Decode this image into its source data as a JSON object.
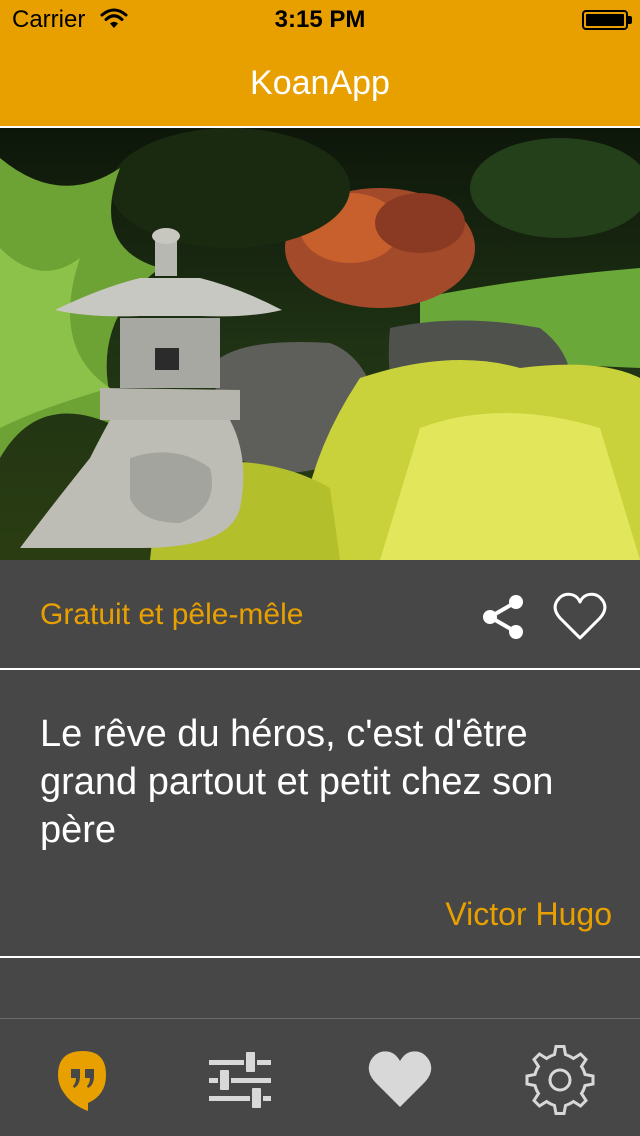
{
  "status_bar": {
    "carrier": "Carrier",
    "time": "3:15 PM"
  },
  "nav": {
    "title": "KoanApp"
  },
  "hero_image": {
    "icon": "garden-lantern-photo"
  },
  "quote_card": {
    "collection": "Gratuit et pêle-mêle",
    "text": "Le rêve du héros, c'est d'être grand partout et petit chez son père",
    "author": "Victor Hugo",
    "actions": [
      "share-icon",
      "heart-outline-icon"
    ]
  },
  "tab_bar": {
    "tabs": [
      {
        "icon": "quote-bubble-icon",
        "selected": true
      },
      {
        "icon": "sliders-icon",
        "selected": false
      },
      {
        "icon": "heart-icon",
        "selected": false
      },
      {
        "icon": "gear-icon",
        "selected": false
      }
    ]
  },
  "colors": {
    "accent": "#E8A000",
    "background": "#474747",
    "text": "#FFFFFF",
    "tab_inactive": "#D8D8D8"
  }
}
